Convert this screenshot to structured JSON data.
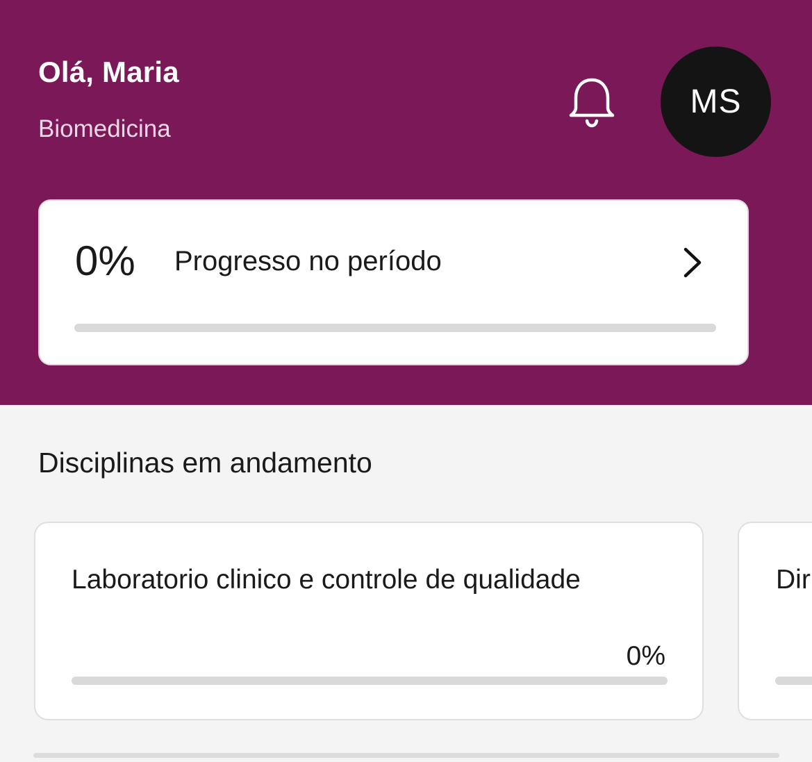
{
  "header": {
    "greeting": "Olá, Maria",
    "course": "Biomedicina",
    "notification_icon": "bell-icon",
    "avatar_initials": "MS"
  },
  "period_progress": {
    "percent_label": "0%",
    "value": 0,
    "label": "Progresso no período",
    "icon": "chevron-right-icon"
  },
  "disciplines": {
    "title": "Disciplinas em andamento",
    "items": [
      {
        "name": "Laboratorio clinico e controle de qualidade",
        "percent_label": "0%",
        "value": 0
      },
      {
        "name": "Dir",
        "percent_label": "",
        "value": 0
      }
    ]
  },
  "colors": {
    "brand": "#7b1857",
    "avatar_bg": "#141414",
    "track": "#d9d9d9",
    "background": "#f4f4f4"
  }
}
